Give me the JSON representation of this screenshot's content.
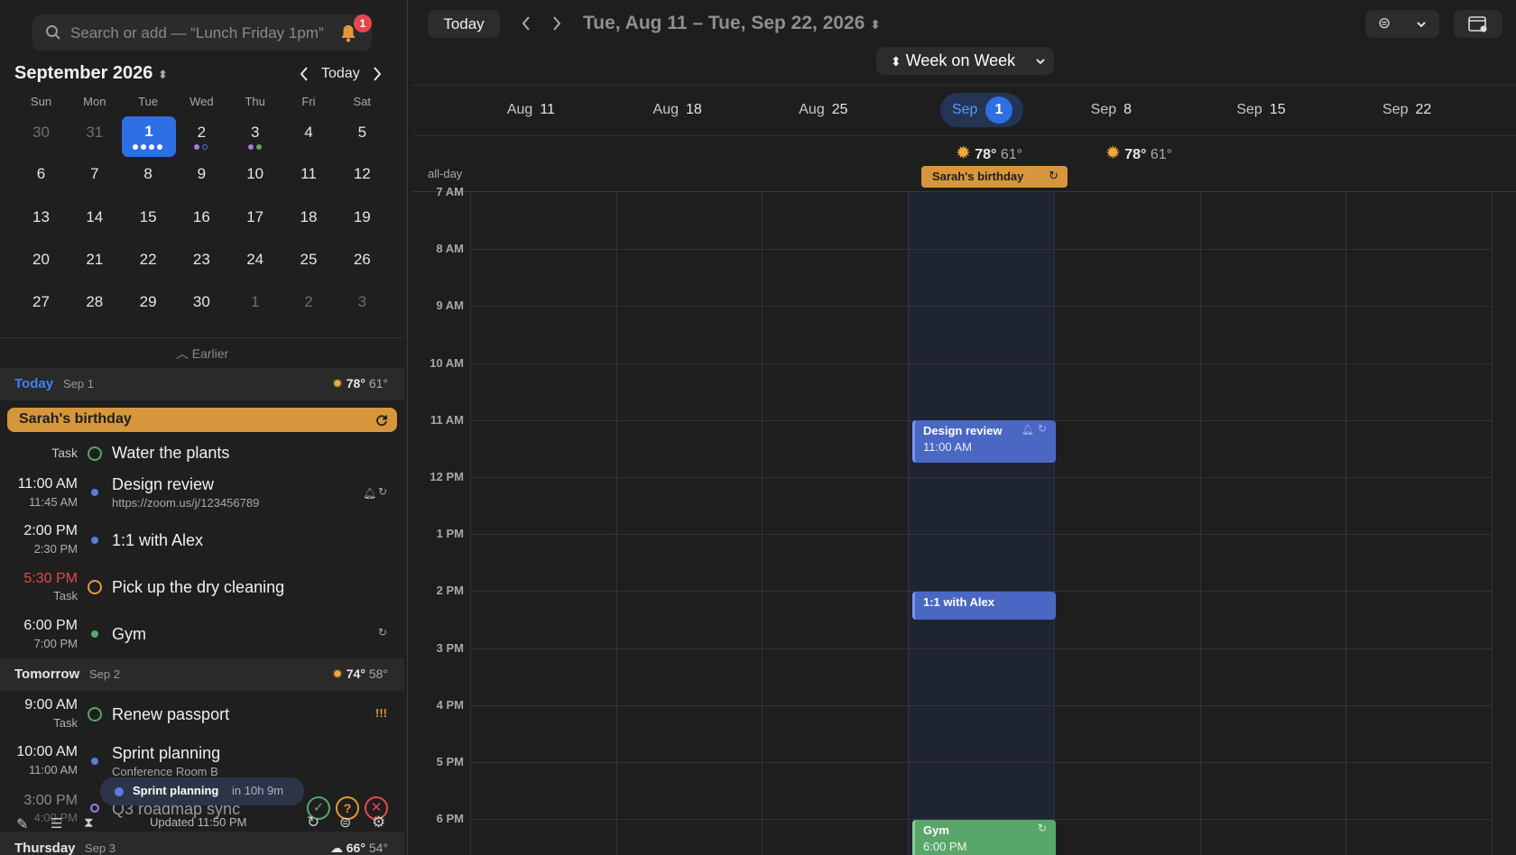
{
  "search": {
    "placeholder": "Search or add — “Lunch Friday 1pm”",
    "badge": "1"
  },
  "mini": {
    "title": "September 2026",
    "today": "Today",
    "dow": [
      "Sun",
      "Mon",
      "Tue",
      "Wed",
      "Thu",
      "Fri",
      "Sat"
    ],
    "weeks": [
      [
        "30",
        "31",
        "1",
        "2",
        "3",
        "4",
        "5"
      ],
      [
        "6",
        "7",
        "8",
        "9",
        "10",
        "11",
        "12"
      ],
      [
        "13",
        "14",
        "15",
        "16",
        "17",
        "18",
        "19"
      ],
      [
        "20",
        "21",
        "22",
        "23",
        "24",
        "25",
        "26"
      ],
      [
        "27",
        "28",
        "29",
        "30",
        "1",
        "2",
        "3"
      ]
    ]
  },
  "list": {
    "earlier": "Earlier",
    "today": {
      "label": "Today",
      "date": "Sep 1",
      "hi": "78°",
      "lo": "61°"
    },
    "birthday": "Sarah's birthday",
    "items": [
      {
        "t": "Task",
        "ttl": "Water the plants"
      },
      {
        "t": "11:00 AM",
        "s": "11:45 AM",
        "ttl": "Design review",
        "sub": "https://zoom.us/j/123456789"
      },
      {
        "t": "2:00 PM",
        "s": "2:30 PM",
        "ttl": "1:1 with Alex"
      },
      {
        "t": "5:30 PM",
        "s": "Task",
        "ttl": "Pick up the dry cleaning"
      },
      {
        "t": "6:00 PM",
        "s": "7:00 PM",
        "ttl": "Gym"
      }
    ],
    "tomorrow": {
      "label": "Tomorrow",
      "date": "Sep 2",
      "hi": "74°",
      "lo": "58°"
    },
    "items2": [
      {
        "t": "9:00 AM",
        "s": "Task",
        "ttl": "Renew passport",
        "flag": "!!!"
      },
      {
        "t": "10:00 AM",
        "s": "11:00 AM",
        "ttl": "Sprint planning",
        "sub": "Conference Room B"
      },
      {
        "t": "3:00 PM",
        "s": "4:00 PM",
        "ttl": "Q3 roadmap sync"
      }
    ],
    "toast": {
      "name": "Sprint planning",
      "when": "in 10h 9m"
    },
    "thursday": {
      "label": "Thursday",
      "date": "Sep 3",
      "hi": "66°",
      "lo": "54°"
    },
    "updated": "Updated 11:50 PM"
  },
  "main": {
    "today": "Today",
    "range": "Tue, Aug 11 – Tue, Sep 22, 2026",
    "view": "Week on Week",
    "cols": [
      {
        "m": "Aug",
        "d": "11"
      },
      {
        "m": "Aug",
        "d": "18"
      },
      {
        "m": "Aug",
        "d": "25"
      },
      {
        "m": "Sep",
        "d": "1"
      },
      {
        "m": "Sep",
        "d": "8"
      },
      {
        "m": "Sep",
        "d": "15"
      },
      {
        "m": "Sep",
        "d": "22"
      }
    ],
    "wx1": {
      "hi": "78°",
      "lo": "61°"
    },
    "wx2": {
      "hi": "78°",
      "lo": "61°"
    },
    "allday": "all-day",
    "birthday": "Sarah's birthday",
    "hours": [
      "7 AM",
      "8 AM",
      "9 AM",
      "10 AM",
      "11 AM",
      "12 PM",
      "1 PM",
      "2 PM",
      "3 PM",
      "4 PM",
      "5 PM",
      "6 PM"
    ],
    "events": {
      "design": {
        "name": "Design review",
        "time": "11:00 AM"
      },
      "alex": {
        "name": "1:1 with Alex"
      },
      "gym": {
        "name": "Gym",
        "time": "6:00 PM"
      }
    }
  },
  "colors": {
    "accent": "#2f6fe4",
    "birthday": "#d6963c",
    "event_blue": "#4a67c4",
    "event_green": "#58a66a"
  }
}
